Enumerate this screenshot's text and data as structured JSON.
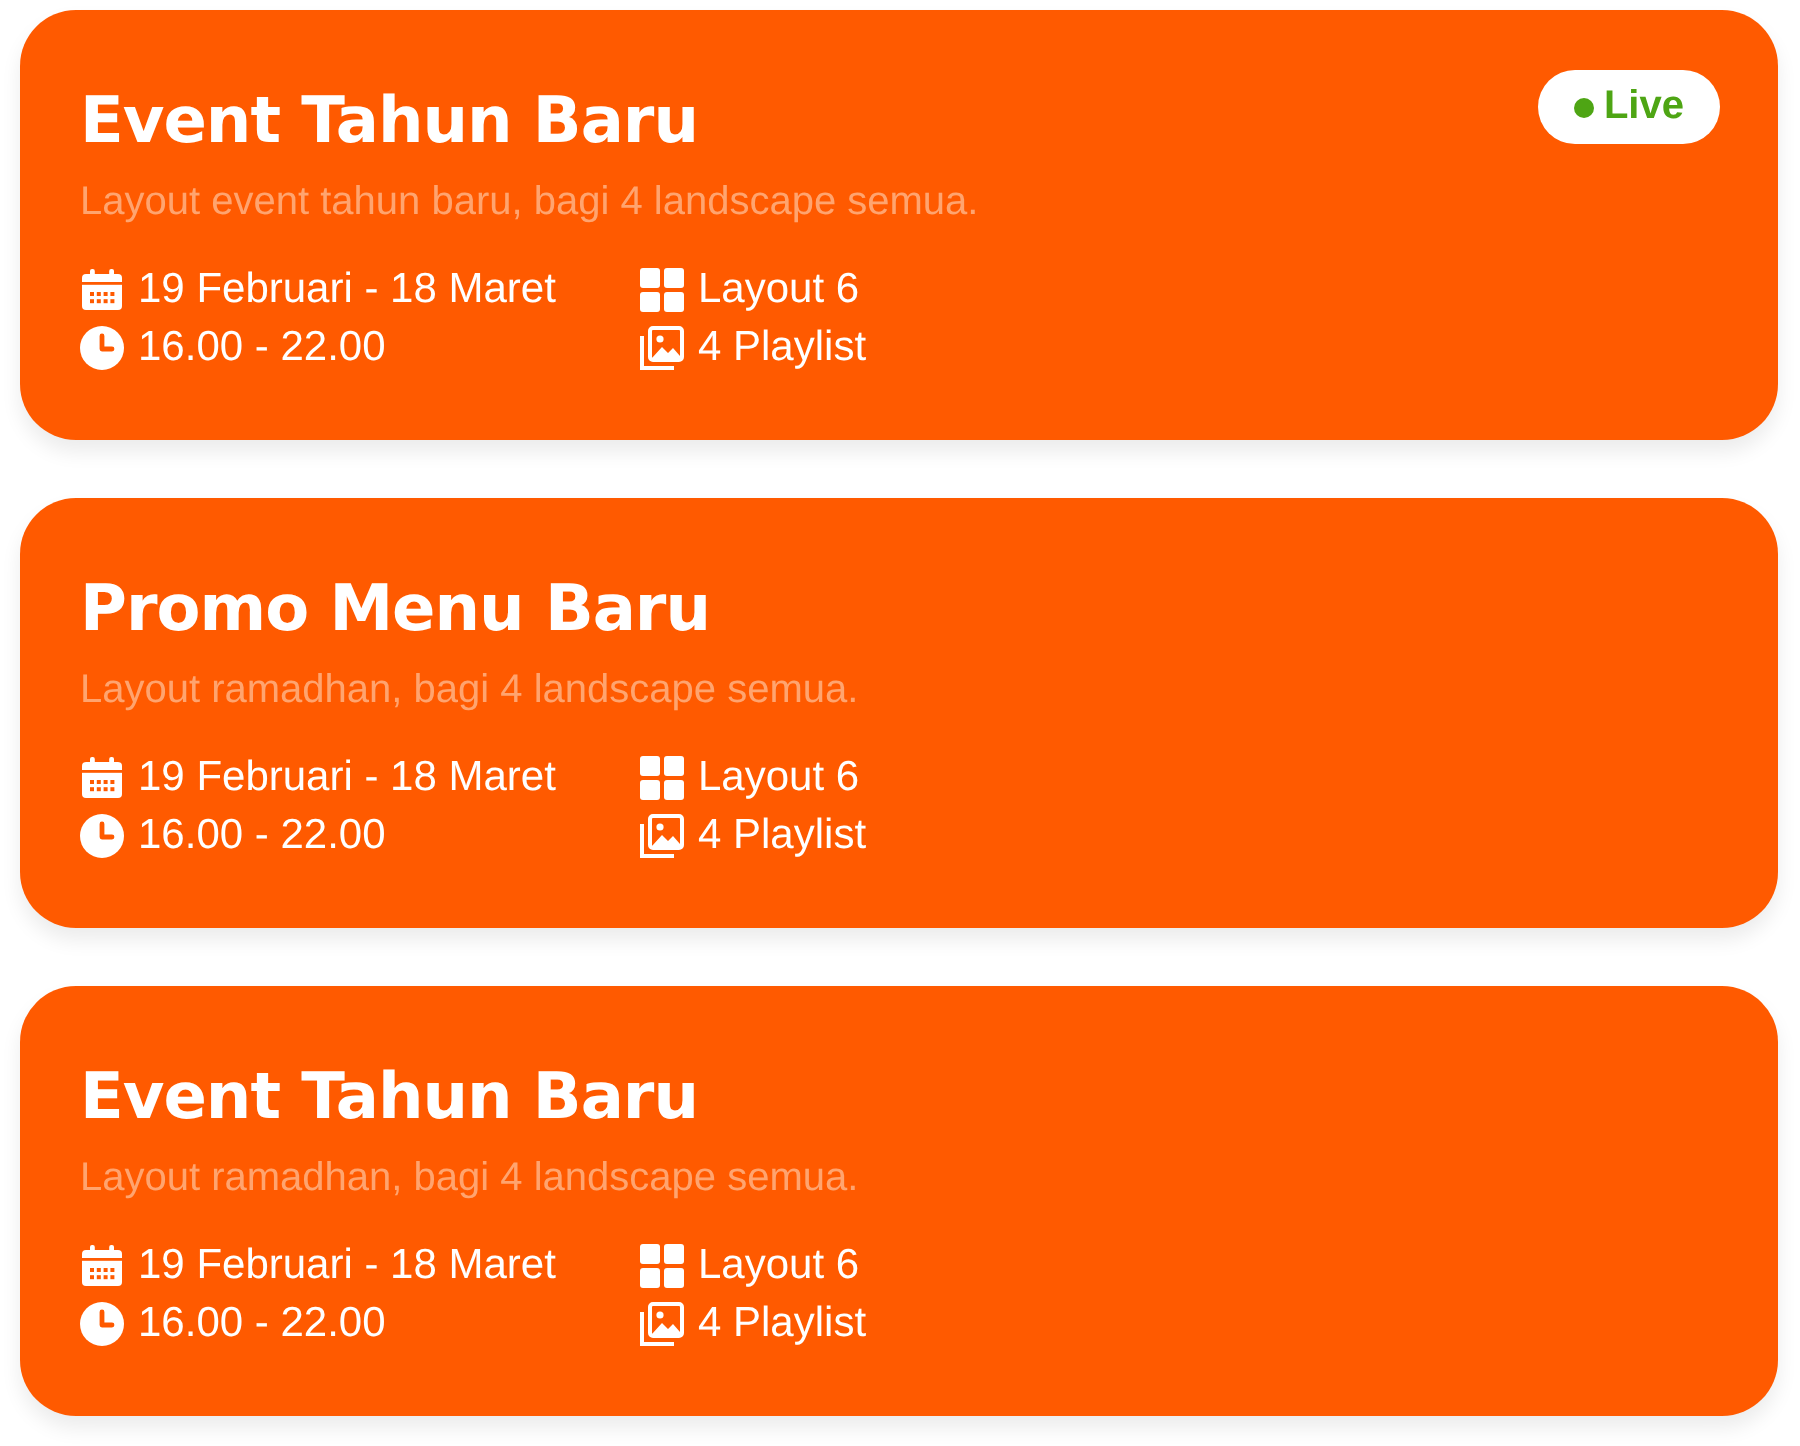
{
  "cards": [
    {
      "title": "Event Tahun Baru",
      "description": "Layout event tahun baru, bagi 4 landscape semua.",
      "live": true,
      "badge": "Live",
      "meta": [
        {
          "kind": "date",
          "text": "19 Februari - 18 Maret"
        },
        {
          "kind": "layout",
          "text": "Layout 6"
        },
        {
          "kind": "time",
          "text": "16.00 - 22.00"
        },
        {
          "kind": "playlist",
          "text": "4 Playlist"
        }
      ]
    },
    {
      "title": "Promo Menu Baru",
      "description": "Layout ramadhan, bagi 4 landscape semua.",
      "live": false,
      "meta": [
        {
          "kind": "date",
          "text": "19 Februari - 18 Maret"
        },
        {
          "kind": "layout",
          "text": "Layout 6"
        },
        {
          "kind": "time",
          "text": "16.00 - 22.00"
        },
        {
          "kind": "playlist",
          "text": "4 Playlist"
        }
      ]
    },
    {
      "title": "Event Tahun Baru",
      "description": "Layout ramadhan, bagi 4 landscape semua.",
      "live": false,
      "meta": [
        {
          "kind": "date",
          "text": "19 Februari - 18 Maret"
        },
        {
          "kind": "layout",
          "text": "Layout 6"
        },
        {
          "kind": "time",
          "text": "16.00 - 22.00"
        },
        {
          "kind": "playlist",
          "text": "4 Playlist"
        }
      ]
    }
  ]
}
